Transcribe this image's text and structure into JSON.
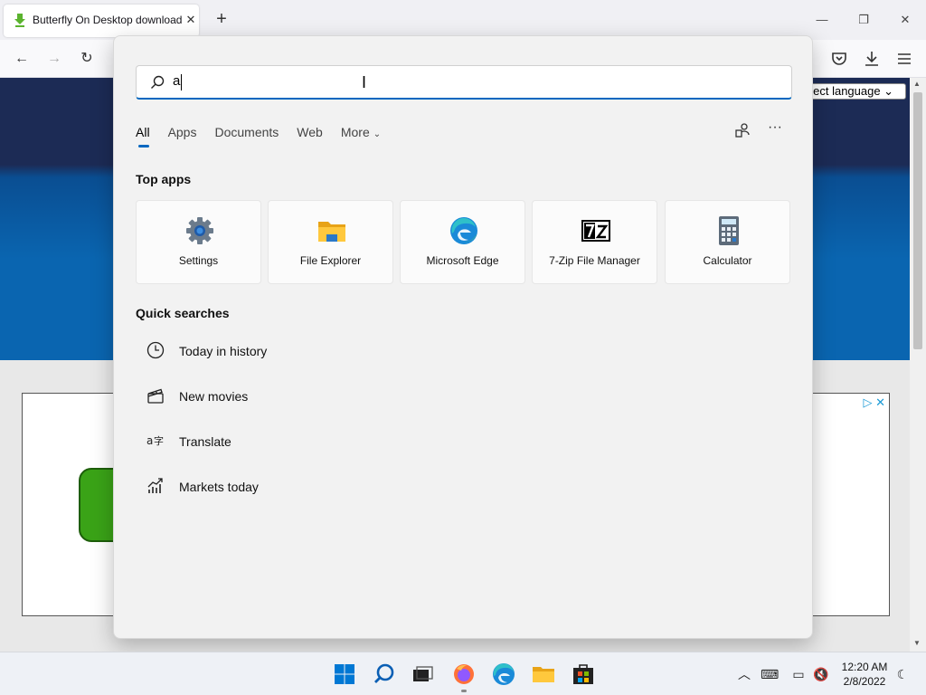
{
  "browser": {
    "tab_title": "Butterfly On Desktop download",
    "tab_close": "✕",
    "new_tab": "+",
    "window_controls": {
      "minimize": "—",
      "restore": "❐",
      "close": "✕"
    }
  },
  "page": {
    "language_select": "elect language ⌄"
  },
  "search": {
    "query": "a",
    "filters": [
      "All",
      "Apps",
      "Documents",
      "Web",
      "More"
    ],
    "active_filter": "All",
    "top_apps_title": "Top apps",
    "top_apps": [
      {
        "label": "Settings",
        "icon": "settings-gear-icon"
      },
      {
        "label": "File Explorer",
        "icon": "folder-icon"
      },
      {
        "label": "Microsoft Edge",
        "icon": "edge-icon"
      },
      {
        "label": "7-Zip File Manager",
        "icon": "7zip-icon"
      },
      {
        "label": "Calculator",
        "icon": "calculator-icon"
      }
    ],
    "quick_searches_title": "Quick searches",
    "quick_searches": [
      {
        "label": "Today in history",
        "icon": "clock-icon"
      },
      {
        "label": "New movies",
        "icon": "clapperboard-icon"
      },
      {
        "label": "Translate",
        "icon": "translate-icon"
      },
      {
        "label": "Markets today",
        "icon": "chart-icon"
      }
    ]
  },
  "taskbar": {
    "time": "12:20 AM",
    "date": "2/8/2022"
  },
  "colors": {
    "accent": "#0067c0",
    "flyout_bg": "#f2f2f2",
    "banner_dark": "#1c2b55",
    "banner_blue": "#0a65b0"
  }
}
